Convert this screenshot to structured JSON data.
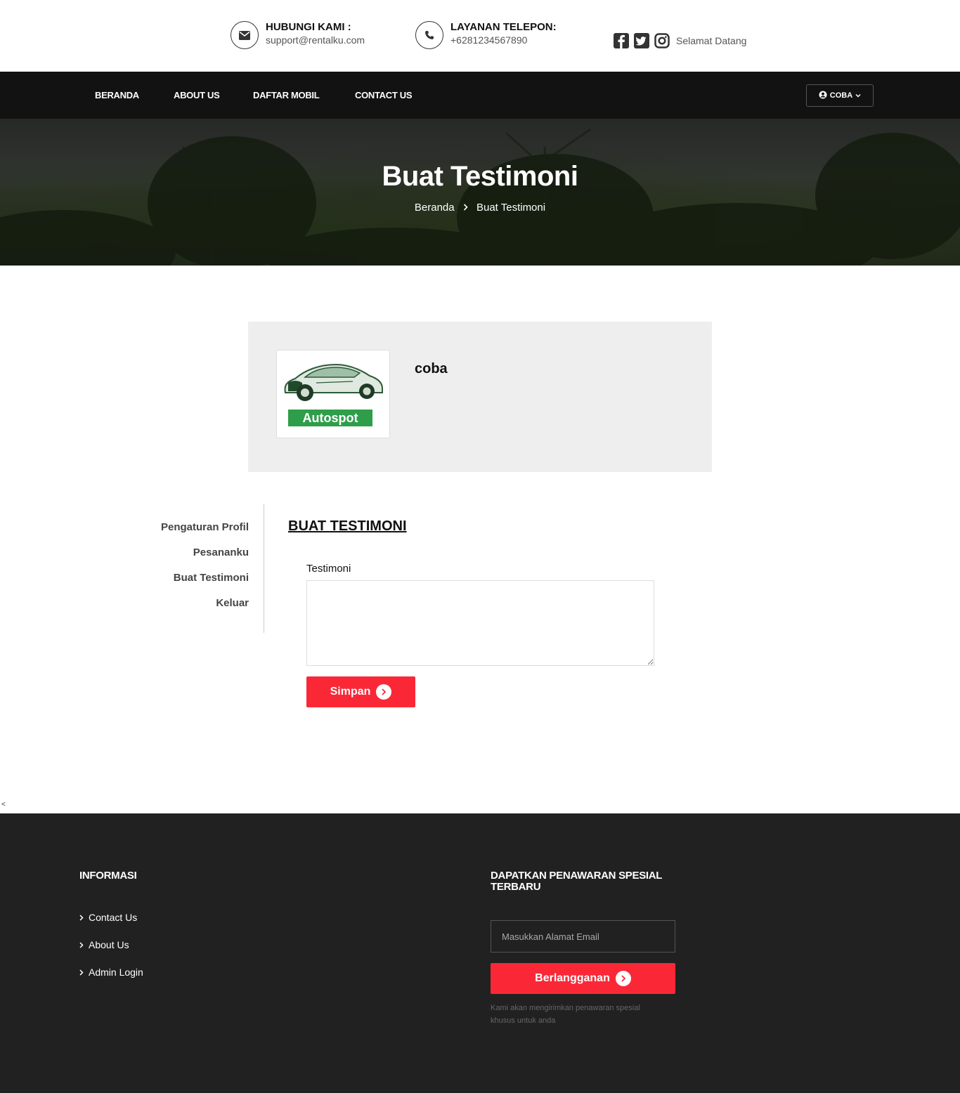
{
  "topbar": {
    "email_title": "HUBUNGI KAMI :",
    "email_value": "support@rentalku.com",
    "phone_title": "LAYANAN TELEPON:",
    "phone_value": "+6281234567890",
    "welcome": "Selamat Datang",
    "social_icons": [
      "facebook-icon",
      "twitter-icon",
      "instagram-icon"
    ]
  },
  "nav": {
    "items": [
      "BERANDA",
      "ABOUT US",
      "DAFTAR MOBIL",
      "CONTACT US"
    ],
    "user_label": "COBA"
  },
  "hero": {
    "title": "Buat Testimoni",
    "breadcrumb": [
      "Beranda",
      "Buat Testimoni"
    ]
  },
  "profile": {
    "avatar_label": "Autospot",
    "name": "coba"
  },
  "sidebar": {
    "items": [
      "Pengaturan Profil",
      "Pesananku",
      "Buat Testimoni",
      "Keluar"
    ]
  },
  "form": {
    "title": "BUAT TESTIMONI",
    "label": "Testimoni",
    "value": "",
    "submit": "Simpan"
  },
  "stray_char": "<",
  "footer": {
    "info_heading": "INFORMASI",
    "links": [
      "Contact Us",
      "About Us",
      "Admin Login"
    ],
    "offer_heading": "DAPATKAN PENAWARAN SPESIAL TERBARU",
    "email_placeholder": "Masukkan Alamat Email",
    "subscribe": "Berlangganan",
    "note": "Kami akan mengirimkan penawaran spesial khusus untuk anda"
  },
  "colors": {
    "accent": "#fa2837",
    "nav_bg": "#121212",
    "footer_bg": "#212121",
    "card_bg": "#eeeeee",
    "badge_green": "#2e9e4a"
  }
}
